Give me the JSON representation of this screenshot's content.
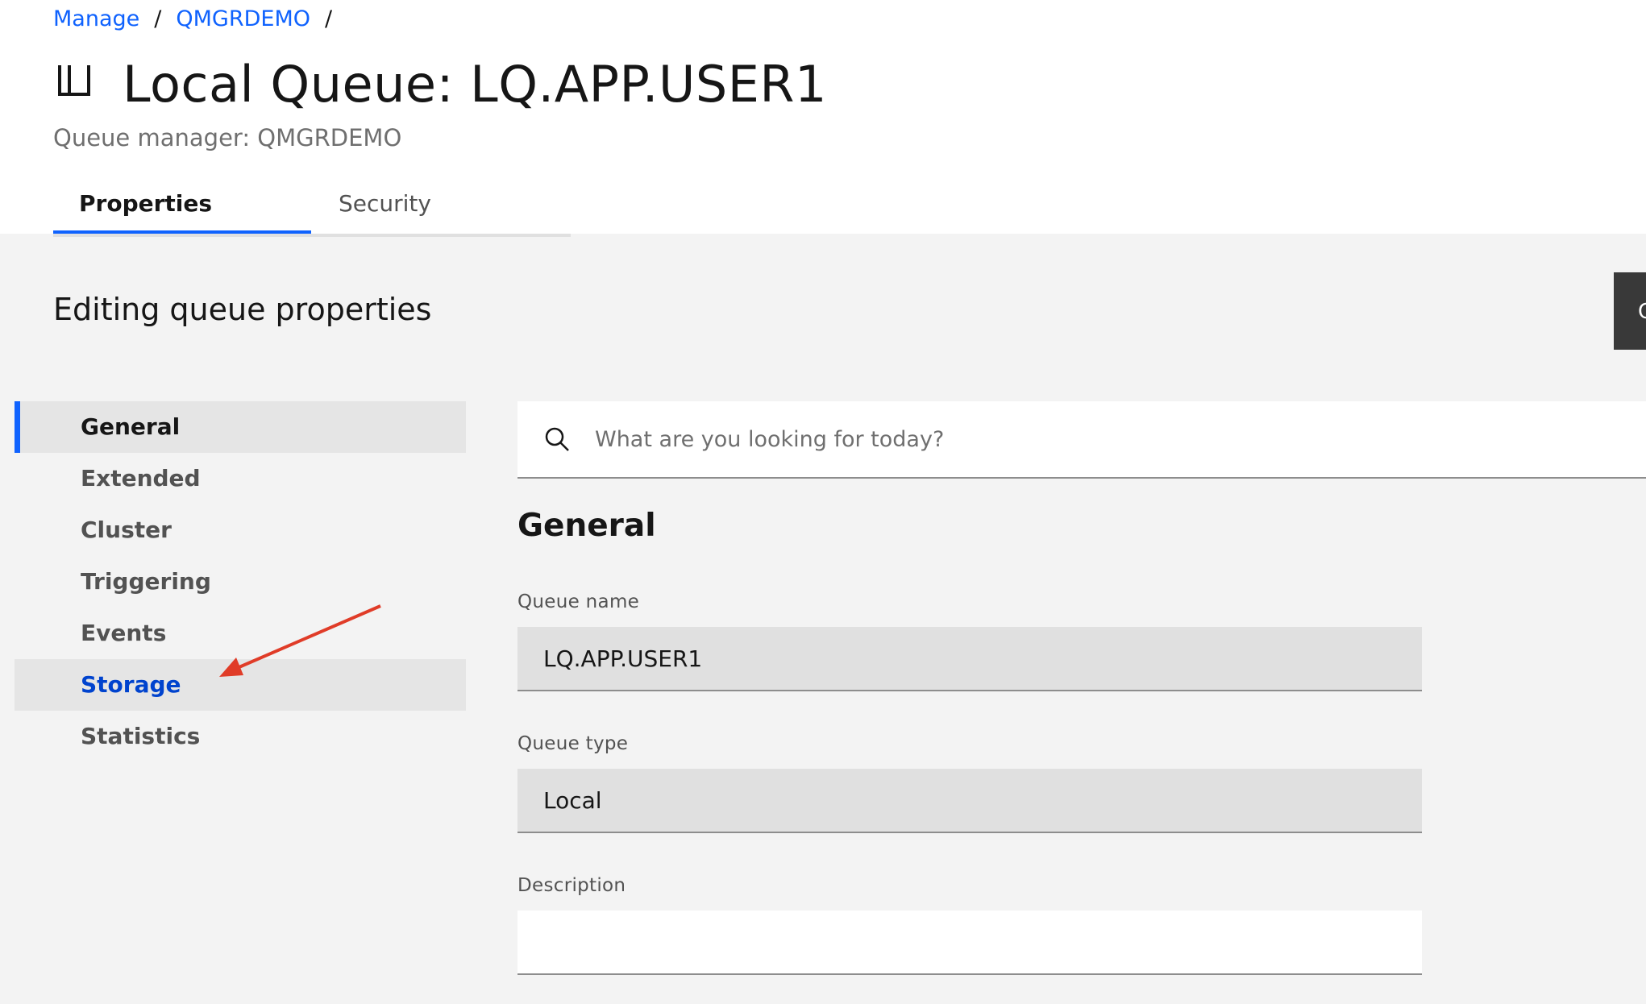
{
  "breadcrumb": {
    "items": [
      "Manage",
      "QMGRDEMO"
    ],
    "separator": "/"
  },
  "header": {
    "title": "Local Queue: LQ.APP.USER1",
    "subtitle": "Queue manager: QMGRDEMO",
    "icon": "local-queue-icon"
  },
  "tabs": [
    {
      "label": "Properties",
      "active": true
    },
    {
      "label": "Security",
      "active": false
    }
  ],
  "page": {
    "section_title": "Editing queue properties",
    "side_button_label": "C"
  },
  "nav": {
    "items": [
      "General",
      "Extended",
      "Cluster",
      "Triggering",
      "Events",
      "Storage",
      "Statistics"
    ],
    "selected": "General",
    "highlighted": "Storage"
  },
  "search": {
    "placeholder": "What are you looking for today?"
  },
  "form": {
    "title": "General",
    "fields": [
      {
        "label": "Queue name",
        "value": "LQ.APP.USER1"
      },
      {
        "label": "Queue type",
        "value": "Local"
      },
      {
        "label": "Description",
        "value": ""
      }
    ]
  },
  "colors": {
    "accent": "#0f62fe",
    "link": "#0f62fe",
    "annotation_arrow": "#e03c28"
  }
}
